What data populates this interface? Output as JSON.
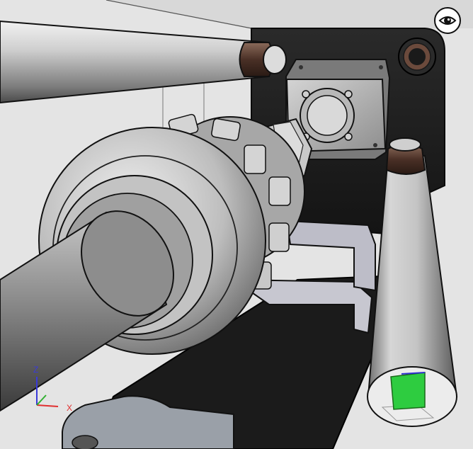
{
  "viewer": {
    "view_toggle_icon": "eye-icon",
    "colors": {
      "background": "#e6e6e6",
      "machine_dark": "#1a1a1a",
      "metal_light": "#d8d8d8",
      "metal_mid": "#9a9a9a",
      "selection_face": "#2ecc40"
    }
  },
  "axis_triad": {
    "z_label": "Z",
    "x_label": "X",
    "z_color": "#3a3ad8",
    "x_color": "#e03030",
    "y_color": "#30b030"
  }
}
